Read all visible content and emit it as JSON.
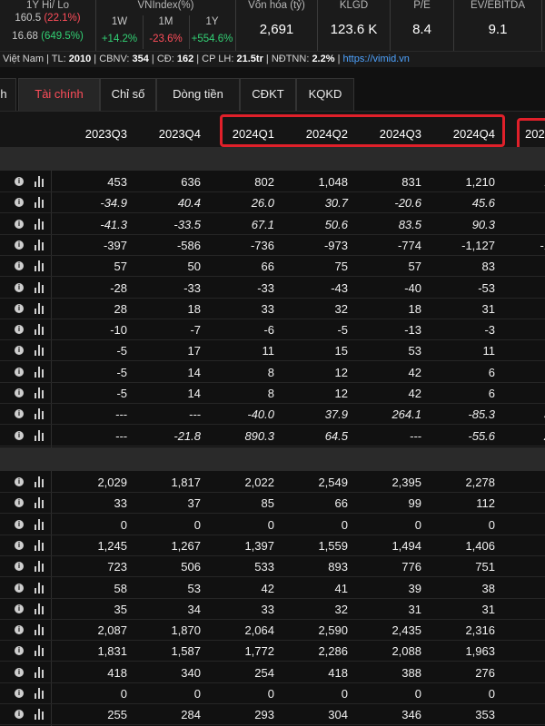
{
  "top": {
    "hilo": {
      "label": "1Y Hi/ Lo",
      "hi": "160.5",
      "hi_pct": "(22.1%)",
      "lo": "16.68",
      "lo_pct": "(649.5%)"
    },
    "vnindex": {
      "label": "VNIndex(%)",
      "headers": [
        "1W",
        "1M",
        "1Y"
      ],
      "values": [
        "+14.2%",
        "-23.6%",
        "+554.6%"
      ]
    },
    "stats": [
      {
        "label": "Vốn hóa (tỷ)",
        "value": "2,691"
      },
      {
        "label": "KLGD",
        "value": "123.6 K"
      },
      {
        "label": "P/E",
        "value": "8.4"
      },
      {
        "label": "EV/EBITDA",
        "value": "9.1"
      }
    ]
  },
  "info": {
    "prefix": "Việt Nam | TL: ",
    "tl": "2010",
    "s1": " | CBNV: ",
    "cbnv": "354",
    "s2": " | CĐ: ",
    "cd": "162",
    "s3": " | CP LH: ",
    "cplh": "21.5tr",
    "s4": " | NĐTNN: ",
    "ndtnn": "2.2%",
    "s5": " | ",
    "link": "https://vimid.vn"
  },
  "tabs": [
    "h",
    "Tài chính",
    "Chỉ số",
    "Dòng tiền",
    "CĐKT",
    "KQKD"
  ],
  "columns": [
    "2023Q3",
    "2023Q4",
    "2024Q1",
    "2024Q2",
    "2024Q3",
    "2024Q4",
    "202"
  ],
  "rows_section1": [
    [
      "453",
      "636",
      "802",
      "1,048",
      "831",
      "1,210",
      "1"
    ],
    [
      "-34.9",
      "40.4",
      "26.0",
      "30.7",
      "-20.6",
      "45.6",
      ""
    ],
    [
      "-41.3",
      "-33.5",
      "67.1",
      "50.6",
      "83.5",
      "90.3",
      ""
    ],
    [
      "-397",
      "-586",
      "-736",
      "-973",
      "-774",
      "-1,127",
      "-1"
    ],
    [
      "57",
      "50",
      "66",
      "75",
      "57",
      "83",
      ""
    ],
    [
      "-28",
      "-33",
      "-33",
      "-43",
      "-40",
      "-53",
      ""
    ],
    [
      "28",
      "18",
      "33",
      "32",
      "18",
      "31",
      ""
    ],
    [
      "-10",
      "-7",
      "-6",
      "-5",
      "-13",
      "-3",
      ""
    ],
    [
      "-5",
      "17",
      "11",
      "15",
      "53",
      "11",
      ""
    ],
    [
      "-5",
      "14",
      "8",
      "12",
      "42",
      "6",
      ""
    ],
    [
      "-5",
      "14",
      "8",
      "12",
      "42",
      "6",
      ""
    ],
    [
      "---",
      "---",
      "-40.0",
      "37.9",
      "264.1",
      "-85.3",
      "3"
    ],
    [
      "---",
      "-21.8",
      "890.3",
      "64.5",
      "---",
      "-55.6",
      "2"
    ]
  ],
  "rows_section2": [
    [
      "2,029",
      "1,817",
      "2,022",
      "2,549",
      "2,395",
      "2,278",
      ""
    ],
    [
      "33",
      "37",
      "85",
      "66",
      "99",
      "112",
      ""
    ],
    [
      "0",
      "0",
      "0",
      "0",
      "0",
      "0",
      ""
    ],
    [
      "1,245",
      "1,267",
      "1,397",
      "1,559",
      "1,494",
      "1,406",
      ""
    ],
    [
      "723",
      "506",
      "533",
      "893",
      "776",
      "751",
      ""
    ],
    [
      "58",
      "53",
      "42",
      "41",
      "39",
      "38",
      ""
    ],
    [
      "35",
      "34",
      "33",
      "32",
      "31",
      "31",
      ""
    ],
    [
      "2,087",
      "1,870",
      "2,064",
      "2,590",
      "2,435",
      "2,316",
      ""
    ],
    [
      "1,831",
      "1,587",
      "1,772",
      "2,286",
      "2,088",
      "1,963",
      ""
    ],
    [
      "418",
      "340",
      "254",
      "418",
      "388",
      "276",
      ""
    ],
    [
      "0",
      "0",
      "0",
      "0",
      "0",
      "0",
      ""
    ],
    [
      "255",
      "284",
      "293",
      "304",
      "346",
      "353",
      ""
    ]
  ],
  "colors": {
    "accent_red": "#ff4d5a",
    "green": "#32d074",
    "link": "#4ea3ff",
    "highlight_box": "#e0202a"
  },
  "icons": [
    "info-icon",
    "bar-chart-icon"
  ]
}
